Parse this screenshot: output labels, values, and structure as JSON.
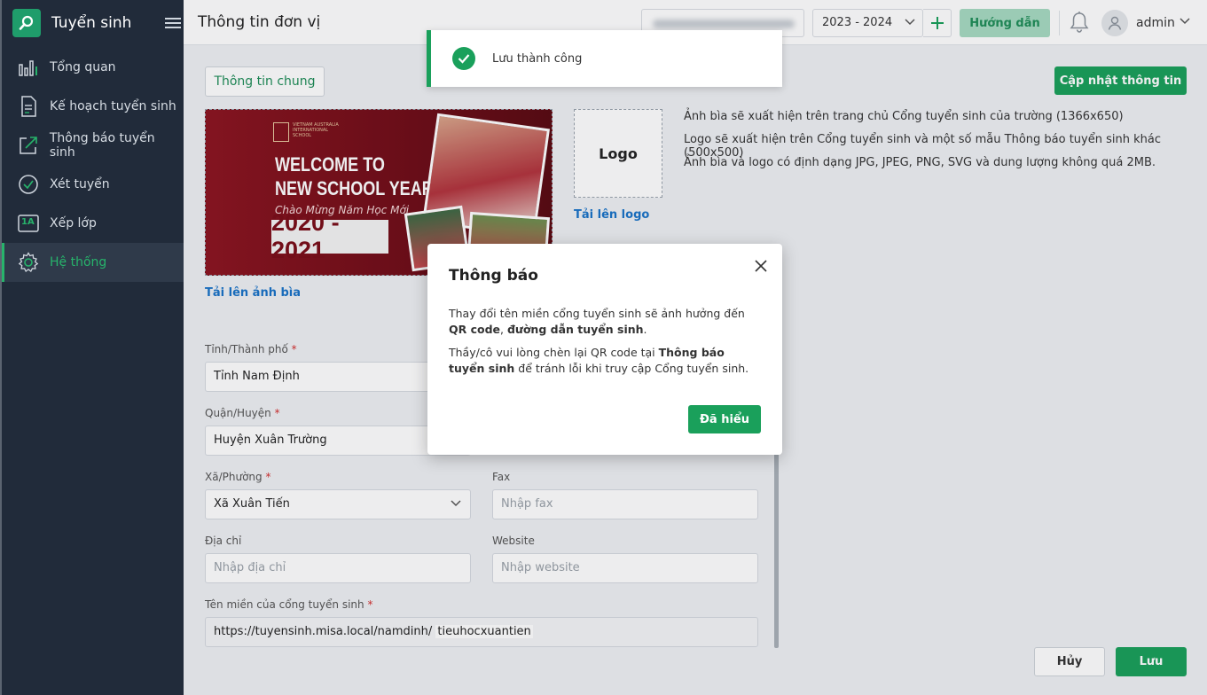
{
  "app": {
    "title": "Tuyển sinh"
  },
  "sidebar": {
    "items": [
      {
        "label": "Tổng quan",
        "icon": "bar-chart-icon"
      },
      {
        "label": "Kế hoạch tuyển sinh",
        "icon": "document-icon"
      },
      {
        "label": "Thông báo tuyển sinh",
        "icon": "share-icon"
      },
      {
        "label": "Xét tuyển",
        "icon": "check-circle-icon"
      },
      {
        "label": "Xếp lớp",
        "icon": "class-1a-icon",
        "badge": "1A"
      },
      {
        "label": "Hệ thống",
        "icon": "gear-icon",
        "active": true
      }
    ]
  },
  "header": {
    "page_title": "Thông tin đơn vị",
    "school_year": "2023 - 2024",
    "guide_label": "Hướng dẫn",
    "user_name": "admin"
  },
  "main": {
    "tab_general": "Thông tin chung",
    "update_info": "Cập nhật thông tin",
    "cover": {
      "welcome_line1": "WELCOME TO",
      "welcome_line2": "NEW SCHOOL YEAR",
      "subtitle": "Chào Mừng Năm Học Mới",
      "year": "2020 - 2021",
      "school_name": "VIETNAM AUSTRALIA INTERNATIONAL SCHOOL"
    },
    "upload_cover": "Tải lên ảnh bìa",
    "logo_label": "Logo",
    "upload_logo": "Tải lên logo",
    "hints": [
      "Ảnh bìa sẽ xuất hiện trên trang chủ Cổng tuyển sinh của trường (1366x650)",
      "Logo sẽ xuất hiện trên Cổng tuyển sinh và một số mẫu Thông báo tuyển sinh khác (500x500)",
      "Ảnh bìa và logo có định dạng JPG, JPEG, PNG, SVG và dung lượng không quá 2MB."
    ],
    "fields": {
      "province": {
        "label": "Tỉnh/Thành phố",
        "required": "*",
        "value": "Tỉnh Nam Định"
      },
      "district": {
        "label": "Quận/Huyện",
        "required": "*",
        "value": "Huyện Xuân Trường"
      },
      "ward": {
        "label": "Xã/Phường",
        "required": "*",
        "value": "Xã Xuân Tiến"
      },
      "fax": {
        "label": "Fax",
        "placeholder": "Nhập fax"
      },
      "address": {
        "label": "Địa chỉ",
        "placeholder": "Nhập địa chỉ"
      },
      "website": {
        "label": "Website",
        "placeholder": "Nhập website"
      },
      "domain": {
        "label": "Tên miền của cổng tuyển sinh",
        "required": "*",
        "prefix": "https://tuyensinh.misa.local/namdinh/",
        "value": "tieuhocxuantien"
      }
    },
    "cancel_label": "Hủy",
    "save_label": "Lưu"
  },
  "toast": {
    "message": "Lưu thành công"
  },
  "dialog": {
    "title": "Thông báo",
    "p1_a": "Thay đổi tên miền cổng tuyển sinh sẽ ảnh hưởng đến ",
    "p1_b": "QR code",
    "p1_c": ", ",
    "p1_d": "đường dẫn tuyển sinh",
    "p1_e": ".",
    "p2_a": "Thầy/cô vui lòng chèn lại QR code tại ",
    "p2_b": "Thông báo tuyển sinh",
    "p2_c": " để tránh lỗi khi truy cập Cổng tuyển sinh.",
    "ok_label": "Đã hiểu"
  },
  "colors": {
    "accent": "#1aa05b",
    "sidebar_bg": "#212b3a",
    "link": "#1a73c8"
  }
}
